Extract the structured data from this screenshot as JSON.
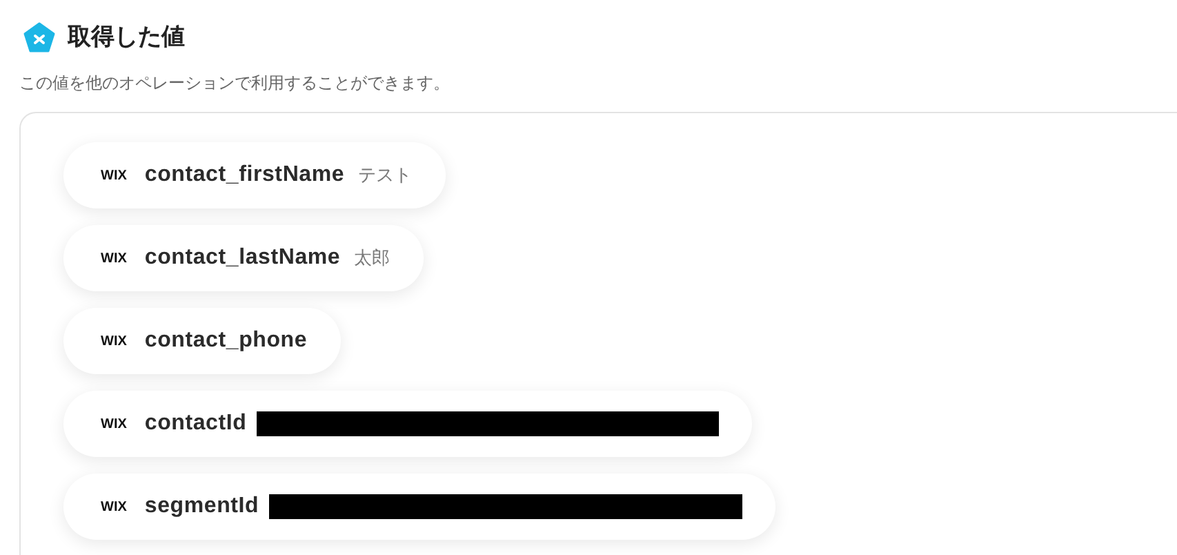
{
  "header": {
    "title": "取得した値",
    "description": "この値を他のオペレーションで利用することができます。"
  },
  "values": [
    {
      "app": "WIX",
      "name": "contact_firstName",
      "value": "テスト",
      "redacted": false
    },
    {
      "app": "WIX",
      "name": "contact_lastName",
      "value": "太郎",
      "redacted": false
    },
    {
      "app": "WIX",
      "name": "contact_phone",
      "redacted": false
    },
    {
      "app": "WIX",
      "name": "contactId",
      "redacted": true
    },
    {
      "app": "WIX",
      "name": "segmentId",
      "redacted": true
    }
  ]
}
